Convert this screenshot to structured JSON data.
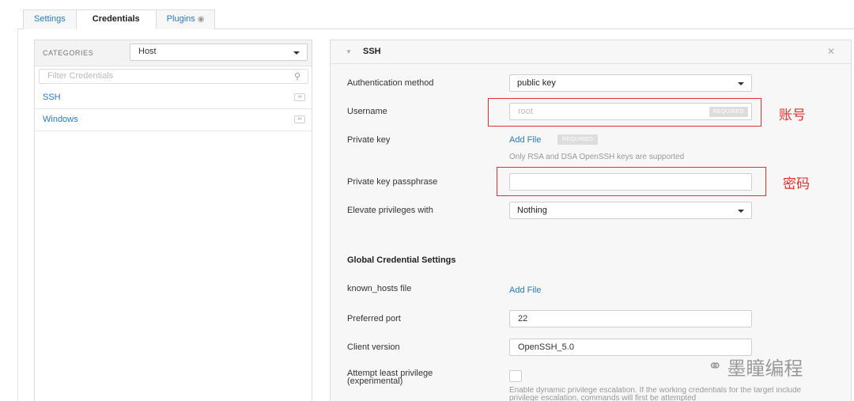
{
  "tabs": [
    {
      "label": "Settings"
    },
    {
      "label": "Credentials"
    },
    {
      "label": "Plugins"
    }
  ],
  "categories": {
    "label": "CATEGORIES",
    "selected": "Host"
  },
  "filter": {
    "placeholder": "Filter Credentials"
  },
  "credentials": [
    {
      "label": "SSH"
    },
    {
      "label": "Windows"
    }
  ],
  "ssh": {
    "title": "SSH",
    "fields": {
      "auth_method": {
        "label": "Authentication method",
        "value": "public key"
      },
      "username": {
        "label": "Username",
        "placeholder": "root",
        "badge": "REQUIRED"
      },
      "private_key": {
        "label": "Private key",
        "action": "Add File",
        "badge": "REQUIRED",
        "help": "Only RSA and DSA OpenSSH keys are supported"
      },
      "passphrase": {
        "label": "Private key passphrase",
        "value": ""
      },
      "elevate": {
        "label": "Elevate privileges with",
        "value": "Nothing"
      }
    },
    "global_section": "Global Credential Settings",
    "known_hosts": {
      "label": "known_hosts file",
      "action": "Add File"
    },
    "port": {
      "label": "Preferred port",
      "value": "22"
    },
    "client_version": {
      "label": "Client version",
      "value": "OpenSSH_5.0"
    },
    "least_privilege": {
      "label": "Attempt least privilege (experimental)",
      "help": "Enable dynamic privilege escalation. If the working credentials for the target include privilege escalation, commands will first be attempted"
    }
  },
  "annotations": {
    "username_note": "账号",
    "password_note": "密码"
  },
  "watermark": {
    "text": "墨瞳编程"
  }
}
